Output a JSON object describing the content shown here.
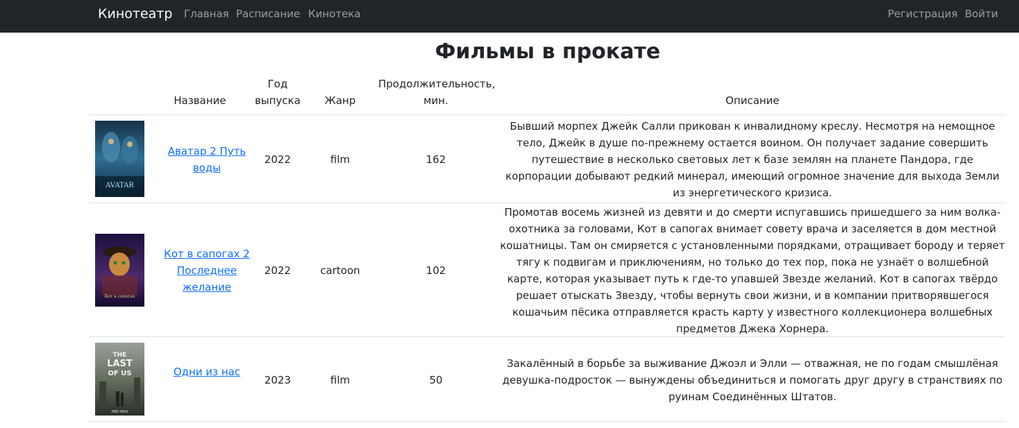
{
  "navbar": {
    "brand": "Кинотеатр",
    "links": [
      "Главная",
      "Расписание",
      "Кинотека"
    ],
    "register": "Регистрация",
    "login": "Войти"
  },
  "page": {
    "title": "Фильмы в прокате"
  },
  "table": {
    "headers": {
      "title": "Название",
      "year": "Год выпуска",
      "genre": "Жанр",
      "duration": "Продолжительность, мин.",
      "description": "Описание"
    },
    "rows": [
      {
        "poster": "avatar-poster",
        "title": "Аватар 2 Путь воды",
        "year": "2022",
        "genre": "film",
        "duration": "162",
        "description": "Бывший морпех Джейк Салли прикован к инвалидному креслу. Несмотря на немощное тело, Джейк в душе по-прежнему остается воином. Он получает задание совершить путешествие в несколько световых лет к базе землян на планете Пандора, где корпорации добывают редкий минерал, имеющий огромное значение для выхода Земли из энергетического кризиса."
      },
      {
        "poster": "puss-in-boots-poster",
        "title": "Кот в сапогах 2 Последнее желание",
        "year": "2022",
        "genre": "cartoon",
        "duration": "102",
        "description": "Промотав восемь жизней из девяти и до смерти испугавшись пришедшего за ним волка-охотника за головами, Кот в сапогах внимает совету врача и заселяется в дом местной кошатницы. Там он смиряется с установленными порядками, отращивает бороду и теряет тягу к подвигам и приключениям, но только до тех пор, пока не узнаёт о волшебной карте, которая указывает путь к где-то упавшей Звезде желаний. Кот в сапогах твёрдо решает отыскать Звезду, чтобы вернуть свои жизни, и в компании притворявшегося кошачьим пёсика отправляется красть карту у известного коллекционера волшебных предметов Джека Хорнера."
      },
      {
        "poster": "the-last-of-us-poster",
        "title": "Одни из нас",
        "year": "2023",
        "genre": "film",
        "duration": "50",
        "description": "Закалённый в борьбе за выживание Джоэл и Элли — отважная, не по годам смышлёная девушка-подросток — вынуждены объединиться и помогать друг другу в странствиях по руинам Соединённых Штатов."
      }
    ]
  },
  "posters": {
    "avatar_text": "AVATAR",
    "puss_text": "Кот в сапогах",
    "tlou_text_1": "THE",
    "tlou_text_2": "LAST",
    "tlou_text_3": "OF US",
    "tlou_brand": "HBO MAX"
  }
}
